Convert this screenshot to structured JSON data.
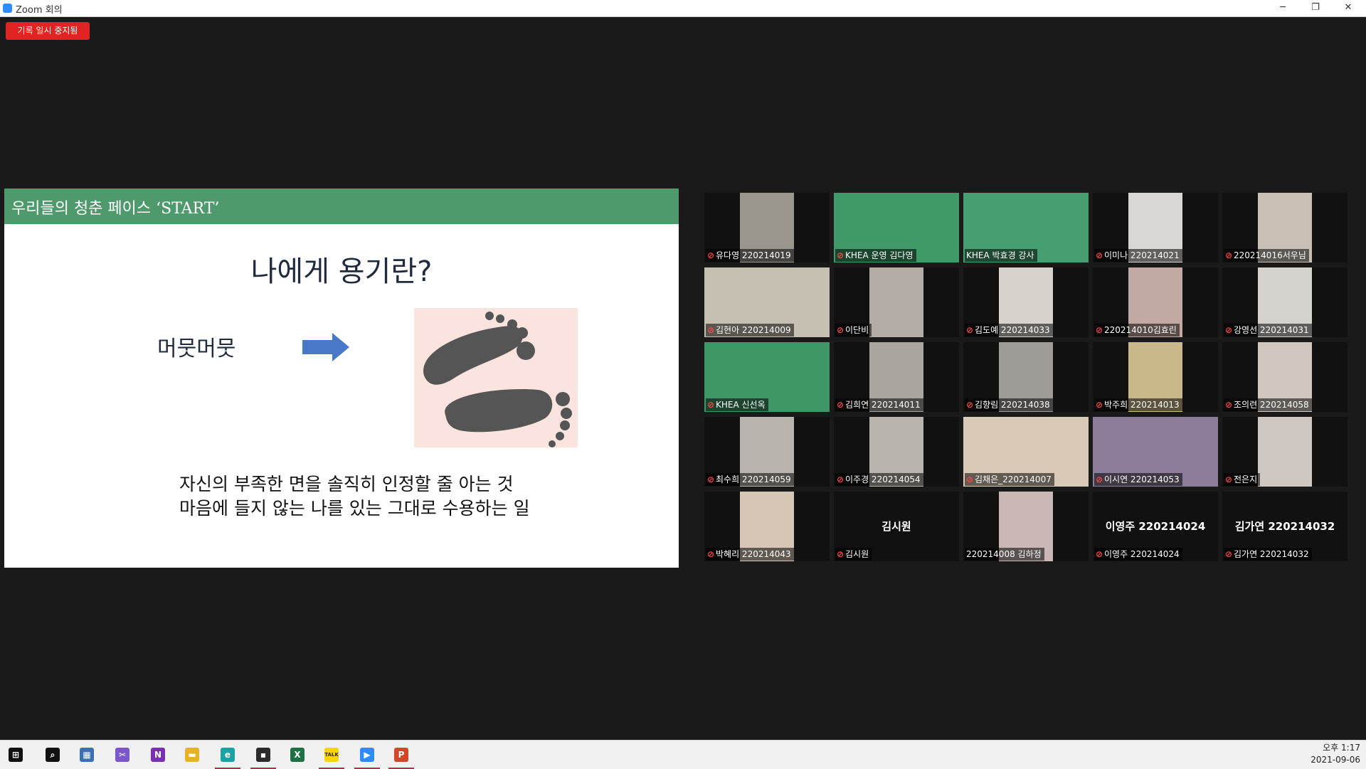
{
  "window": {
    "title": "Zoom 회의",
    "minimize": "─",
    "restore": "❐",
    "close": "✕"
  },
  "recording_badge": "기록 일시 중지됨",
  "slide": {
    "header": "우리들의 청춘 페이스 ‘START’",
    "title": "나에게 용기란?",
    "word": "머뭇머뭇",
    "line1": "자신의 부족한 면을 솔직히 인정할 줄 아는 것",
    "line2": "마음에 들지 않는 나를 있는 그대로 수용하는 일",
    "colors": {
      "header": "#4f9a6c",
      "arrow": "#4a78c8",
      "feet": "#555555",
      "feet_bg": "#fbe4e0"
    }
  },
  "participants": [
    {
      "name": "유다영 220214019",
      "muted": true,
      "bg": "#9a968e"
    },
    {
      "name": "KHEA 운영 김다영",
      "muted": true,
      "bg": "#3f9a68"
    },
    {
      "name": "KHEA 박효경 강사",
      "muted": false,
      "speaking": true,
      "bg": "#479e70"
    },
    {
      "name": "이미나 220214021",
      "muted": true,
      "bg": "#d9d6d3"
    },
    {
      "name": "220214016서우님",
      "muted": true,
      "bg": "#c9c1b6"
    },
    {
      "name": "김현아 220214009",
      "muted": true,
      "bg": "#c5c0b2"
    },
    {
      "name": "이단비",
      "muted": true,
      "bg": "#b4aca6"
    },
    {
      "name": "김도예 220214033",
      "muted": true,
      "bg": "#d7d3cc"
    },
    {
      "name": "220214010김효린",
      "muted": true,
      "bg": "#c3a9a3"
    },
    {
      "name": "강영선 220214031",
      "muted": true,
      "bg": "#d5d1cd"
    },
    {
      "name": "KHEA 신선옥",
      "muted": true,
      "bg": "#3f9767"
    },
    {
      "name": "김희연 220214011",
      "muted": true,
      "bg": "#aaa59f"
    },
    {
      "name": "김향림 220214038",
      "muted": true,
      "bg": "#9f9b97"
    },
    {
      "name": "박주희 220214013",
      "muted": true,
      "bg": "#c9b88a"
    },
    {
      "name": "조의련 220214058",
      "muted": true,
      "bg": "#d2c7bf"
    },
    {
      "name": "최수희 220214059",
      "muted": true,
      "bg": "#b9b3ad"
    },
    {
      "name": "이주경 220214054",
      "muted": true,
      "bg": "#b8b3ac"
    },
    {
      "name": "김채은_220214007",
      "muted": true,
      "bg": "#d9c9b7"
    },
    {
      "name": "이시연 220214053",
      "muted": true,
      "bg": "#8c7d9a"
    },
    {
      "name": "전은지",
      "muted": true,
      "bg": "#cfc7c2"
    },
    {
      "name": "박혜리 220214043",
      "muted": true,
      "bg": "#d6c6b5"
    },
    {
      "name": "김시원",
      "muted": true,
      "big": "김시원"
    },
    {
      "name": "220214008 김하정",
      "muted": false,
      "bg": "#c9b8b5"
    },
    {
      "name": "이영주 220214024",
      "muted": true,
      "big": "이영주 220214024"
    },
    {
      "name": "김가연 220214032",
      "muted": true,
      "big": "김가연 220214032"
    }
  ],
  "taskbar": {
    "icons": [
      {
        "name": "start-icon",
        "text": "⊞",
        "color": "#111111"
      },
      {
        "name": "search-icon",
        "text": "⌕",
        "color": "#111111"
      },
      {
        "name": "calculator-icon",
        "text": "▦",
        "color": "#3a6fb5"
      },
      {
        "name": "snipping-tool-icon",
        "text": "✂",
        "color": "#7b57c9"
      },
      {
        "name": "onenote-icon",
        "text": "N",
        "color": "#7a2fb2"
      },
      {
        "name": "file-explorer-icon",
        "text": "▬",
        "color": "#e6b422"
      },
      {
        "name": "edge-icon",
        "text": "e",
        "color": "#1aa3a3",
        "active": true
      },
      {
        "name": "sticky-notes-icon",
        "text": "▪",
        "color": "#2b2b2b",
        "active": true
      },
      {
        "name": "excel-icon",
        "text": "X",
        "color": "#1e7145"
      },
      {
        "name": "kakaotalk-icon",
        "text": "TALK",
        "color": "#f7d600",
        "active": true
      },
      {
        "name": "zoom-icon",
        "text": "▶",
        "color": "#2d8cff",
        "active": true
      },
      {
        "name": "powerpoint-icon",
        "text": "P",
        "color": "#d24726",
        "active": true
      }
    ],
    "time": "오후 1:17",
    "date": "2021-09-06"
  }
}
